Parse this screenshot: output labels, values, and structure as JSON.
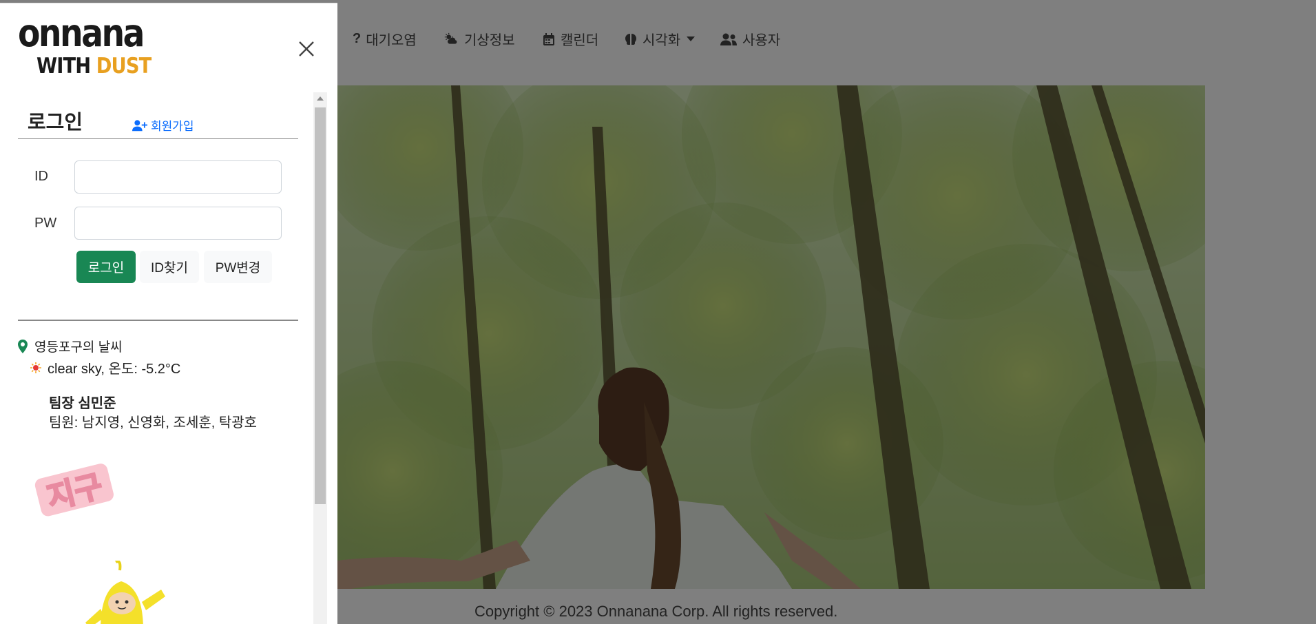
{
  "nav": {
    "items": [
      {
        "label": "대기오염",
        "icon": "question-icon"
      },
      {
        "label": "기상정보",
        "icon": "cloud-sun-icon"
      },
      {
        "label": "캘린더",
        "icon": "calendar-icon"
      },
      {
        "label": "시각화",
        "icon": "brain-icon",
        "dropdown": true
      },
      {
        "label": "사용자",
        "icon": "users-icon"
      }
    ]
  },
  "footer": {
    "copyright": "Copyright © 2023 Onnanana Corp. All rights reserved."
  },
  "panel": {
    "logo": {
      "line1": "onnana",
      "line2_prefix": "WITH ",
      "line2_accent": "DUST"
    },
    "login": {
      "title": "로그인",
      "signup_label": "회원가입",
      "id_label": "ID",
      "pw_label": "PW",
      "id_value": "",
      "pw_value": "",
      "login_button": "로그인",
      "find_id_button": "ID찾기",
      "change_pw_button": "PW변경"
    },
    "weather": {
      "location": "영등포구의 날씨",
      "description": "clear sky, 온도: -5.2°C",
      "icon": "sun-icon"
    },
    "team": {
      "leader": "팀장 심민준",
      "members": "팀원: 남지영, 신영화, 조세훈, 탁광호"
    },
    "sticker_text": "지구"
  },
  "colors": {
    "primary_link": "#0d6efd",
    "success": "#198754",
    "logo_accent": "#e8a020",
    "overlay": "rgba(0,0,0,0.5)"
  }
}
